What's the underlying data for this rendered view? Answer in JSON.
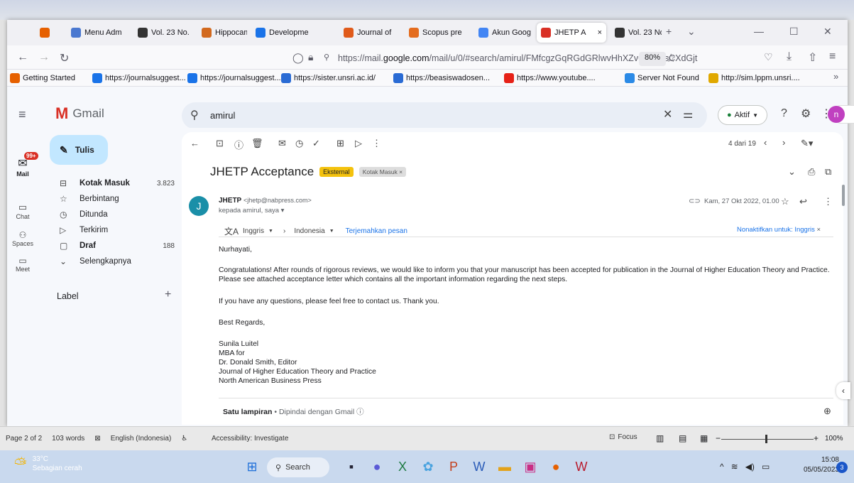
{
  "browser": {
    "tabs": [
      {
        "label": "",
        "icon": "firefox-icon",
        "color": "#e66000"
      },
      {
        "label": "Menu Adm",
        "icon": "puzzle-icon",
        "color": "#4a78d0"
      },
      {
        "label": "Vol. 23 No.",
        "icon": "pkp-icon",
        "color": "#333333"
      },
      {
        "label": "Hippocamp",
        "icon": "e-icon",
        "color": "#d2691e"
      },
      {
        "label": "Developme",
        "icon": "doc-icon",
        "color": "#1a73e8"
      },
      {
        "label": "Journal of",
        "icon": "sjr-icon",
        "color": "#e05a1a"
      },
      {
        "label": "Scopus pre",
        "icon": "sc-icon",
        "color": "#e46c1e"
      },
      {
        "label": "Akun Goog",
        "icon": "google-icon",
        "color": "#4285f4"
      },
      {
        "label": "JHETP A",
        "icon": "gmail-icon",
        "color": "#d93025"
      },
      {
        "label": "Vol. 23 No.",
        "icon": "pkp-icon",
        "color": "#333333"
      }
    ],
    "url_prefix": "https://mail.",
    "url_domain": "google.com",
    "url_rest": "/mail/u/0/#search/amirul/FMfcgzGqRGdGRlwvHhXZvCRCGsCXdGjt",
    "zoom": "80%",
    "bookmarks": [
      {
        "label": "Getting Started",
        "icon": "firefox-icon"
      },
      {
        "label": "https://journalsuggest...",
        "icon": "journal-icon"
      },
      {
        "label": "https://journalsuggest...",
        "icon": "journal-icon"
      },
      {
        "label": "https://sister.unsri.ac.id/",
        "icon": "unsri-icon"
      },
      {
        "label": "https://beasiswadosen...",
        "icon": "unsri-icon"
      },
      {
        "label": "https://www.youtube....",
        "icon": "youtube-icon"
      },
      {
        "label": "Server Not Found",
        "icon": "server-icon"
      },
      {
        "label": "http://sim.lppm.unsri....",
        "icon": "lppm-icon"
      }
    ]
  },
  "gmail": {
    "logo": "Gmail",
    "search_value": "amirul",
    "status": "Aktif",
    "avatar": "n",
    "compose": "Tulis",
    "mail_badge": "99+",
    "rail": [
      "Mail",
      "Chat",
      "Spaces",
      "Meet"
    ],
    "nav": [
      {
        "label": "Kotak Masuk",
        "count": "3.823",
        "bold": true,
        "icon": "inbox-icon"
      },
      {
        "label": "Berbintang",
        "count": "",
        "bold": false,
        "icon": "star-icon"
      },
      {
        "label": "Ditunda",
        "count": "",
        "bold": false,
        "icon": "clock-icon"
      },
      {
        "label": "Terkirim",
        "count": "",
        "bold": false,
        "icon": "send-icon"
      },
      {
        "label": "Draf",
        "count": "188",
        "bold": true,
        "icon": "draft-icon"
      },
      {
        "label": "Selengkapnya",
        "count": "",
        "bold": false,
        "icon": "chevron-down-icon"
      }
    ],
    "label_heading": "Label",
    "pager": "4 dari 19",
    "message": {
      "subject": "JHETP Acceptance",
      "tag_external": "Eksternal",
      "tag_inbox": "Kotak Masuk ×",
      "sender_name": "JHETP",
      "sender_email": "<jhetp@nabpress.com>",
      "recipients": "kepada amirul, saya ▾",
      "date": "Kam, 27 Okt 2022, 01.00",
      "translate_from": "Inggris",
      "translate_to": "Indonesia",
      "translate_link": "Terjemahkan pesan",
      "translate_off": "Nonaktifkan untuk: Inggris",
      "greeting": "Nurhayati,",
      "para1": "Congratulations! After rounds of rigorous reviews, we would like to inform you that your manuscript has been accepted for publication in the Journal of Higher Education Theory and Practice. Please see attached acceptance letter which contains all the important information regarding the next steps.",
      "para2": "If you have any questions, please feel free to contact us. Thank you.",
      "closing": "Best Regards,",
      "sig1": "Sunila Luitel",
      "sig2": "MBA for",
      "sig3": "Dr. Donald Smith, Editor",
      "sig4": "Journal of Higher Education Theory and Practice",
      "sig5": "North American Business Press",
      "attachment": "Satu lampiran",
      "scan": "• Dipindai dengan Gmail ⓘ"
    }
  },
  "word_status": {
    "page": "Page 2 of 2",
    "words": "103 words",
    "language": "English (Indonesia)",
    "accessibility": "Accessibility: Investigate",
    "focus": "Focus",
    "zoom": "100%"
  },
  "taskbar": {
    "temp": "33°C",
    "weather": "Sebagian cerah",
    "search": "Search",
    "time": "15:08",
    "date": "05/05/2023"
  }
}
